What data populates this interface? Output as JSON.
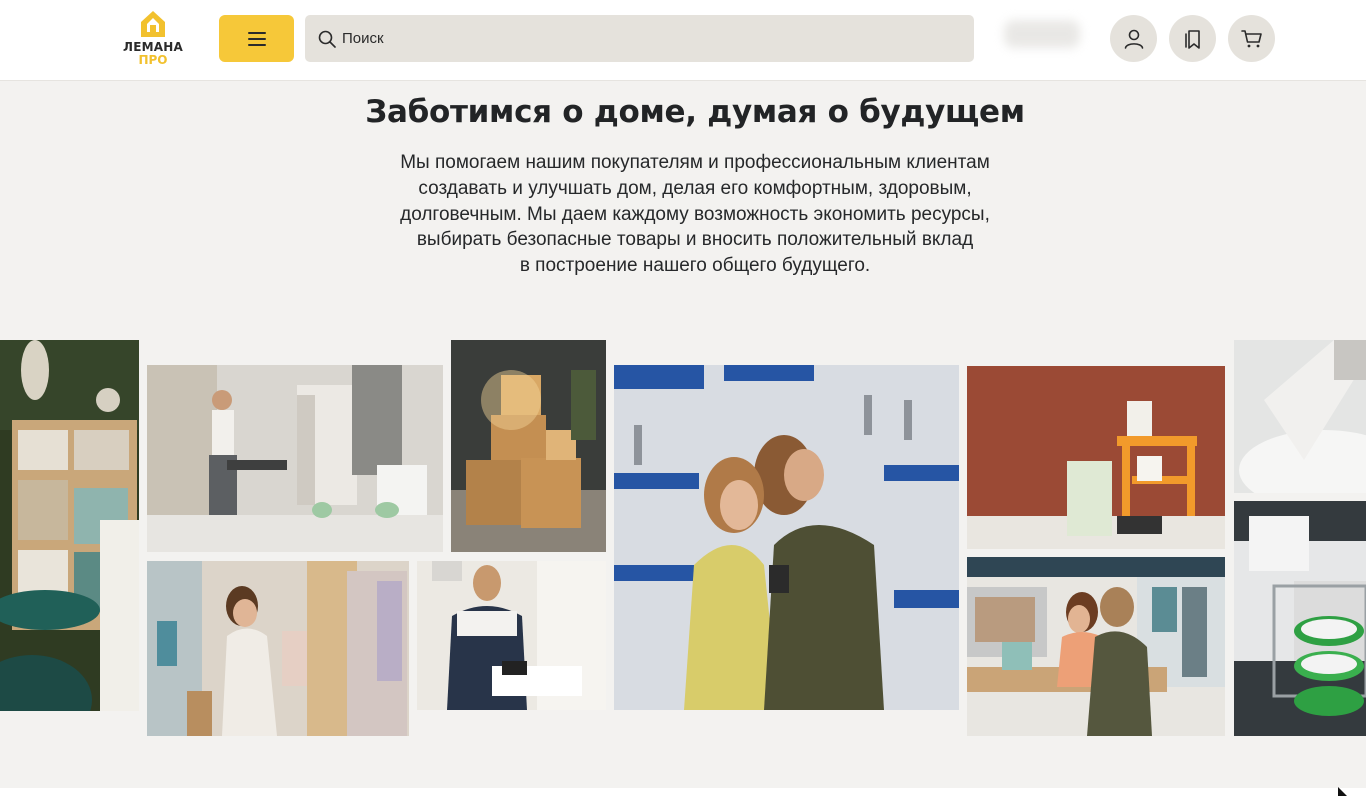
{
  "header": {
    "logo": {
      "line1": "ЛЕМАНА",
      "line2": "ПРО"
    },
    "search": {
      "placeholder": "Поиск"
    }
  },
  "hero": {
    "title": "Заботимся о доме, думая о будущем",
    "text_lines": [
      "Мы помогаем нашим покупателям и профессиональным клиентам",
      "создавать и улучшать дом, делая его комфортным, здоровым,",
      "долговечным. Мы даем каждому возможность экономить ресурсы,",
      "выбирать безопасные товары и вносить положительный вклад",
      "в построение нашего общего будущего."
    ]
  },
  "colors": {
    "brand_yellow": "#f6c839",
    "header_bg": "#ffffff",
    "page_bg": "#f3f2f0",
    "control_bg": "#e5e2dc"
  },
  "icons": [
    "menu-icon",
    "search-icon",
    "user-icon",
    "bookmark-icon",
    "cart-icon"
  ]
}
